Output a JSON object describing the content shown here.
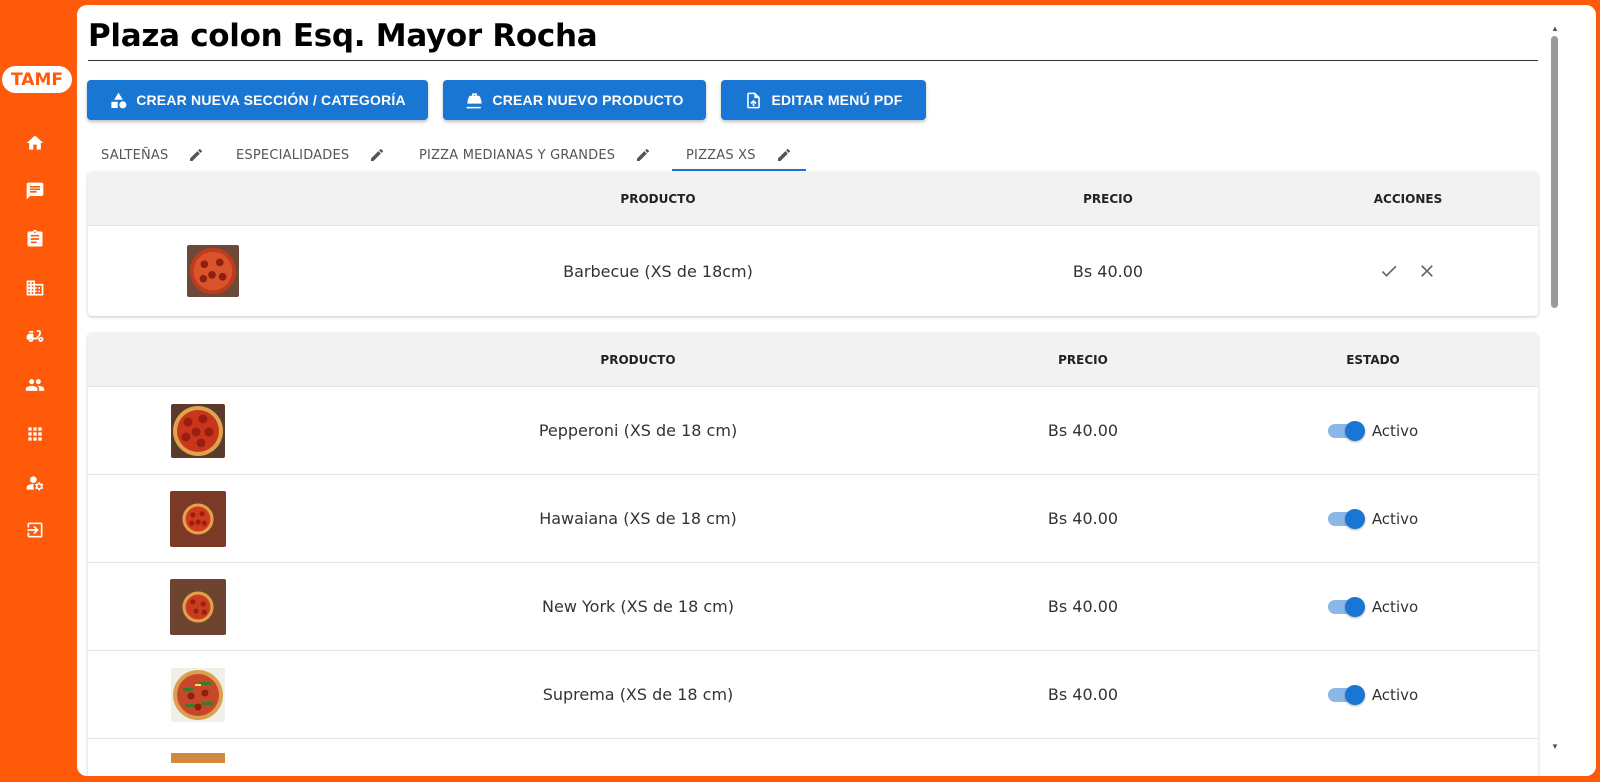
{
  "brand": {
    "logo_text": "TAMF",
    "accent": "#ff5a0a",
    "primary": "#1976d2"
  },
  "sidebar": {
    "items": [
      {
        "name": "home-icon"
      },
      {
        "name": "chat-icon"
      },
      {
        "name": "clipboard-icon"
      },
      {
        "name": "building-icon"
      },
      {
        "name": "delivery-scooter-icon"
      },
      {
        "name": "people-icon"
      },
      {
        "name": "apps-grid-icon"
      },
      {
        "name": "user-settings-icon"
      },
      {
        "name": "logout-icon"
      }
    ]
  },
  "page": {
    "title": "Plaza colon Esq. Mayor Rocha"
  },
  "toolbar": {
    "create_section": "CREAR NUEVA SECCIÓN / CATEGORÍA",
    "create_product": "CREAR NUEVO PRODUCTO",
    "edit_menu_pdf": "EDITAR MENÚ PDF"
  },
  "tabs": [
    {
      "label": "SALTEÑAS"
    },
    {
      "label": "ESPECIALIDADES"
    },
    {
      "label": "PIZZA MEDIANAS Y GRANDES"
    },
    {
      "label": "PIZZAS XS",
      "active": true
    }
  ],
  "pending_table": {
    "headers": {
      "product": "PRODUCTO",
      "price": "PRECIO",
      "actions": "ACCIONES"
    },
    "rows": [
      {
        "product": "Barbecue (XS de 18cm)",
        "price": "Bs 40.00"
      }
    ]
  },
  "products_table": {
    "headers": {
      "product": "PRODUCTO",
      "price": "PRECIO",
      "status": "ESTADO"
    },
    "rows": [
      {
        "product": "Pepperoni (XS de 18 cm)",
        "price": "Bs 40.00",
        "status": "Activo",
        "active": true
      },
      {
        "product": "Hawaiana (XS de 18 cm)",
        "price": "Bs 40.00",
        "status": "Activo",
        "active": true
      },
      {
        "product": "New York (XS de 18 cm)",
        "price": "Bs 40.00",
        "status": "Activo",
        "active": true
      },
      {
        "product": "Suprema (XS de 18 cm)",
        "price": "Bs 40.00",
        "status": "Activo",
        "active": true
      }
    ]
  }
}
